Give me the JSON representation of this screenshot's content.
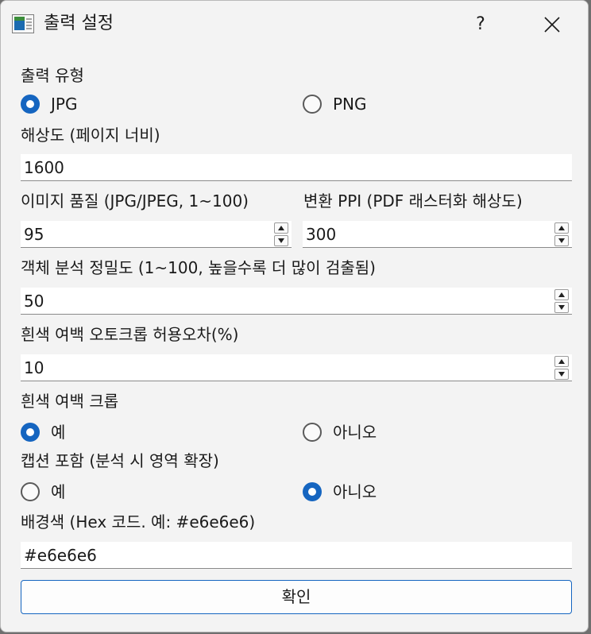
{
  "window": {
    "title": "출력 설정",
    "help_label": "?",
    "app_icon": "settings-app-icon",
    "close_icon": "close-icon"
  },
  "output_type": {
    "label": "출력 유형",
    "options": [
      "JPG",
      "PNG"
    ],
    "selected": "JPG"
  },
  "resolution": {
    "label": "해상도 (페이지 너비)",
    "value": "1600"
  },
  "image_quality": {
    "label": "이미지 품질 (JPG/JPEG, 1~100)",
    "value": "95"
  },
  "convert_ppi": {
    "label": "변환 PPI (PDF 래스터화 해상도)",
    "value": "300"
  },
  "object_precision": {
    "label": "객체 분석 정밀도 (1~100, 높을수록 더 많이 검출됨)",
    "value": "50"
  },
  "autocrop_tolerance": {
    "label": "흰색 여백 오토크롭 허용오차(%)",
    "value": "10"
  },
  "whitespace_crop": {
    "label": "흰색 여백 크롭",
    "options": [
      "예",
      "아니오"
    ],
    "selected": "예"
  },
  "include_caption": {
    "label": "캡션 포함 (분석 시 영역 확장)",
    "options": [
      "예",
      "아니오"
    ],
    "selected": "아니오"
  },
  "background_color": {
    "label": "배경색 (Hex 코드. 예: #e6e6e6)",
    "value": "#e6e6e6"
  },
  "confirm_label": "확인",
  "colors": {
    "accent": "#1565c0",
    "window_bg": "#f3f3f3",
    "field_bg": "#ffffff"
  }
}
